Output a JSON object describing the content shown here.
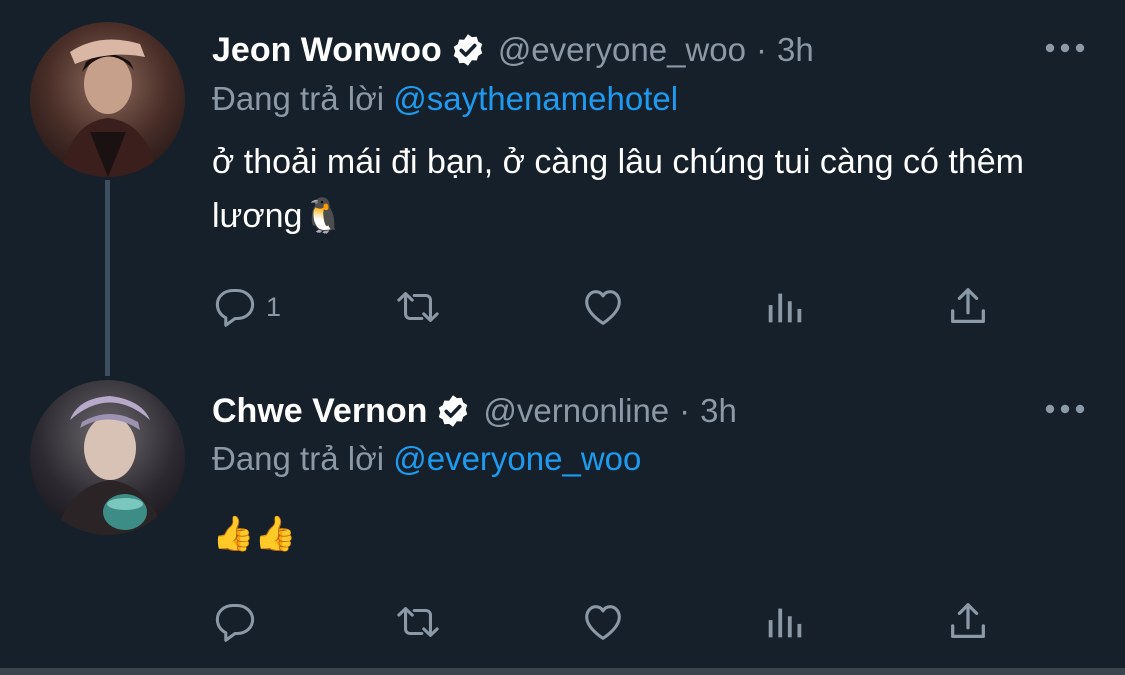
{
  "tweets": [
    {
      "display_name": "Jeon Wonwoo",
      "handle": "@everyone_woo",
      "separator": "·",
      "time": "3h",
      "reply_prefix": "Đang trả lời",
      "reply_to": "@saythenamehotel",
      "text": "ở thoải mái đi bạn, ở càng lâu chúng tui càng có thêm lương🐧",
      "reply_count": "1",
      "icons": [
        "avatar",
        "verified-badge-icon",
        "more-icon",
        "reply-icon",
        "retweet-icon",
        "like-icon",
        "analytics-icon",
        "share-icon"
      ]
    },
    {
      "display_name": "Chwe Vernon",
      "handle": "@vernonline",
      "separator": "·",
      "time": "3h",
      "reply_prefix": "Đang trả lời",
      "reply_to": "@everyone_woo",
      "text": "👍👍",
      "reply_count": "",
      "icons": [
        "avatar",
        "verified-badge-icon",
        "more-icon",
        "reply-icon",
        "retweet-icon",
        "like-icon",
        "analytics-icon",
        "share-icon"
      ]
    }
  ],
  "colors": {
    "background": "#15202b",
    "secondary_text": "#8b98a5",
    "link": "#1d9bf0",
    "thread_line": "#3d4e5e"
  }
}
